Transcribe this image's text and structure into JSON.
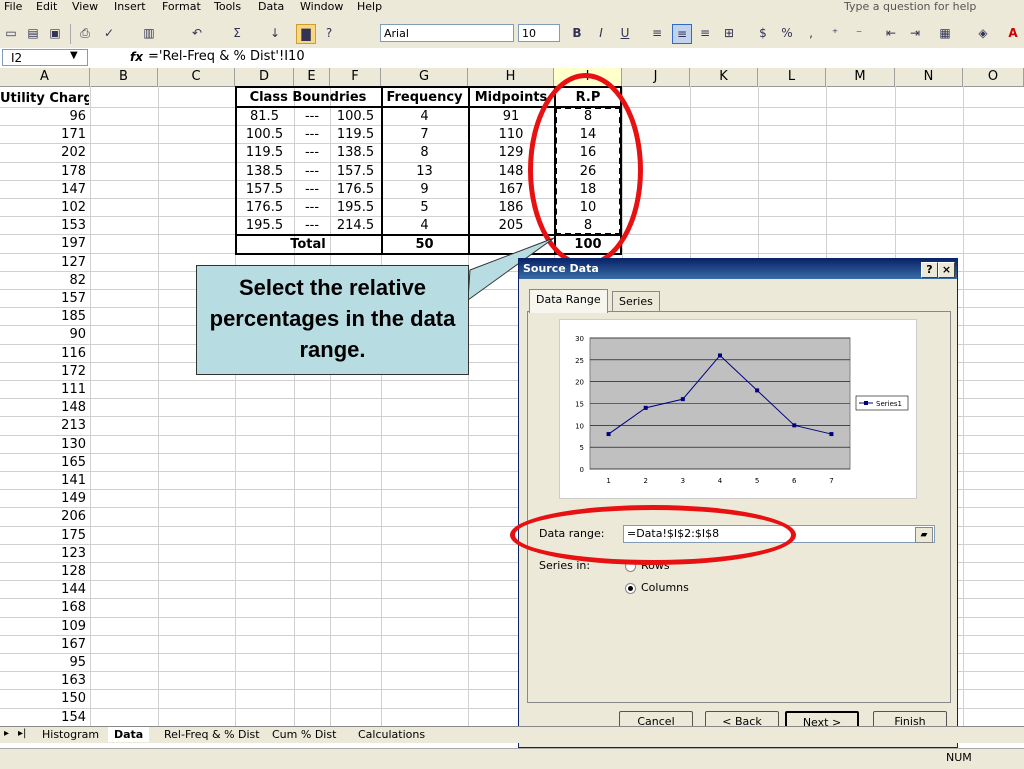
{
  "menu": [
    "File",
    "Edit",
    "View",
    "Insert",
    "Format",
    "Tools",
    "Data",
    "Window",
    "Help"
  ],
  "help_placeholder": "Type a question for help",
  "toolbar": {
    "font": "Arial",
    "size": "10"
  },
  "formula": {
    "cell_ref": "I2",
    "fx": "fx",
    "content": "='Rel-Freq & % Dist'!I10"
  },
  "columns": [
    "A",
    "B",
    "C",
    "D",
    "E",
    "F",
    "G",
    "H",
    "I",
    "J",
    "K",
    "L",
    "M",
    "N",
    "O"
  ],
  "col_a_header": "Utility Charge",
  "col_a_values": [
    "96",
    "171",
    "202",
    "178",
    "147",
    "102",
    "153",
    "197",
    "127",
    "82",
    "157",
    "185",
    "90",
    "116",
    "172",
    "111",
    "148",
    "213",
    "130",
    "165",
    "141",
    "149",
    "206",
    "175",
    "123",
    "128",
    "144",
    "168",
    "109",
    "167",
    "95",
    "163",
    "150",
    "154"
  ],
  "table": {
    "header_class": "Class Boundries",
    "header_freq": "Frequency",
    "header_mid": "Midpoints",
    "header_rp": "R.P",
    "rows": [
      [
        "81.5",
        "---",
        "100.5",
        "4",
        "91",
        "8"
      ],
      [
        "100.5",
        "---",
        "119.5",
        "7",
        "110",
        "14"
      ],
      [
        "119.5",
        "---",
        "138.5",
        "8",
        "129",
        "16"
      ],
      [
        "138.5",
        "---",
        "157.5",
        "13",
        "148",
        "26"
      ],
      [
        "157.5",
        "---",
        "176.5",
        "9",
        "167",
        "18"
      ],
      [
        "176.5",
        "---",
        "195.5",
        "5",
        "186",
        "10"
      ],
      [
        "195.5",
        "---",
        "214.5",
        "4",
        "205",
        "8"
      ]
    ],
    "total_label": "Total",
    "total_freq": "50",
    "total_rp": "100"
  },
  "callout": "Select the relative percentages in the data range.",
  "dialog": {
    "title": "Source Data",
    "tab_data_range": "Data Range",
    "tab_series": "Series",
    "data_range_label": "Data range:",
    "data_range_value": "=Data!$I$2:$I$8",
    "series_in_label": "Series in:",
    "rows_label": "Rows",
    "columns_label": "Columns",
    "btn_cancel": "Cancel",
    "btn_back": "< Back",
    "btn_next": "Next >",
    "btn_finish": "Finish"
  },
  "chart_data": {
    "type": "line",
    "categories": [
      "1",
      "2",
      "3",
      "4",
      "5",
      "6",
      "7"
    ],
    "series": [
      {
        "name": "Series1",
        "values": [
          8,
          14,
          16,
          26,
          18,
          10,
          8
        ]
      }
    ],
    "ylim": [
      0,
      30
    ],
    "yticks": [
      "0",
      "5",
      "10",
      "15",
      "20",
      "25",
      "30"
    ],
    "grid": true,
    "legend": "right",
    "colors": {
      "line": "#000080",
      "plot_bg": "#c0c0c0"
    }
  },
  "sheet_tabs": [
    "Histogram",
    "Data",
    "Rel-Freq & % Dist",
    "Cum % Dist",
    "Calculations"
  ],
  "active_tab": "Data",
  "status": "NUM"
}
